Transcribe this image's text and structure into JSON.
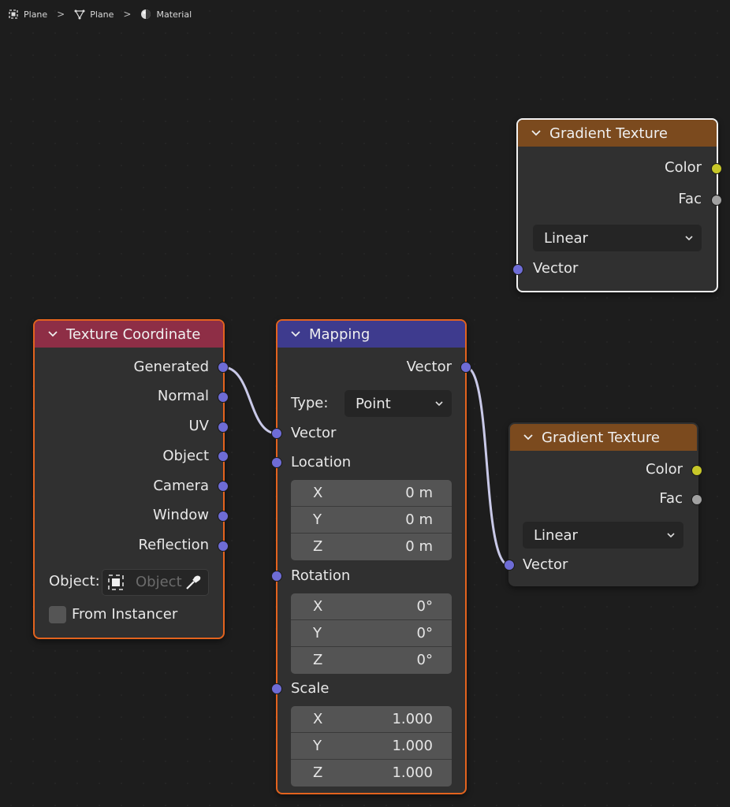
{
  "breadcrumb": {
    "items": [
      {
        "label": "Plane",
        "icon": "object-icon"
      },
      {
        "label": "Plane",
        "icon": "mesh-icon"
      },
      {
        "label": "Material",
        "icon": "material-icon"
      }
    ],
    "separator": ">"
  },
  "nodes": {
    "gradient_top": {
      "title": "Gradient Texture",
      "outputs": [
        "Color",
        "Fac"
      ],
      "dropdown_value": "Linear",
      "input": "Vector"
    },
    "texture_coordinate": {
      "title": "Texture Coordinate",
      "outputs": [
        "Generated",
        "Normal",
        "UV",
        "Object",
        "Camera",
        "Window",
        "Reflection"
      ],
      "object_label": "Object:",
      "object_placeholder": "Object",
      "from_instancer_label": "From Instancer"
    },
    "mapping": {
      "title": "Mapping",
      "output": "Vector",
      "type_label": "Type:",
      "type_value": "Point",
      "vector_input": "Vector",
      "location": {
        "label": "Location",
        "x_label": "X",
        "x": "0 m",
        "y_label": "Y",
        "y": "0 m",
        "z_label": "Z",
        "z": "0 m"
      },
      "rotation": {
        "label": "Rotation",
        "x_label": "X",
        "x": "0°",
        "y_label": "Y",
        "y": "0°",
        "z_label": "Z",
        "z": "0°"
      },
      "scale": {
        "label": "Scale",
        "x_label": "X",
        "x": "1.000",
        "y_label": "Y",
        "y": "1.000",
        "z_label": "Z",
        "z": "1.000"
      }
    },
    "gradient_bottom": {
      "title": "Gradient Texture",
      "outputs": [
        "Color",
        "Fac"
      ],
      "dropdown_value": "Linear",
      "input": "Vector"
    }
  },
  "colors": {
    "background": "#1d1d1d",
    "node_body": "#303030",
    "header_texture_coordinate": "#8e2e46",
    "header_mapping": "#3e3b8e",
    "header_gradient": "#7b4a1e",
    "selection_active": "#f2f2f2",
    "selection": "#e3631e",
    "socket_vector": "#6e6cd6",
    "socket_color": "#c7c729",
    "socket_float": "#a1a1a1",
    "link": "#c9c9e8"
  }
}
